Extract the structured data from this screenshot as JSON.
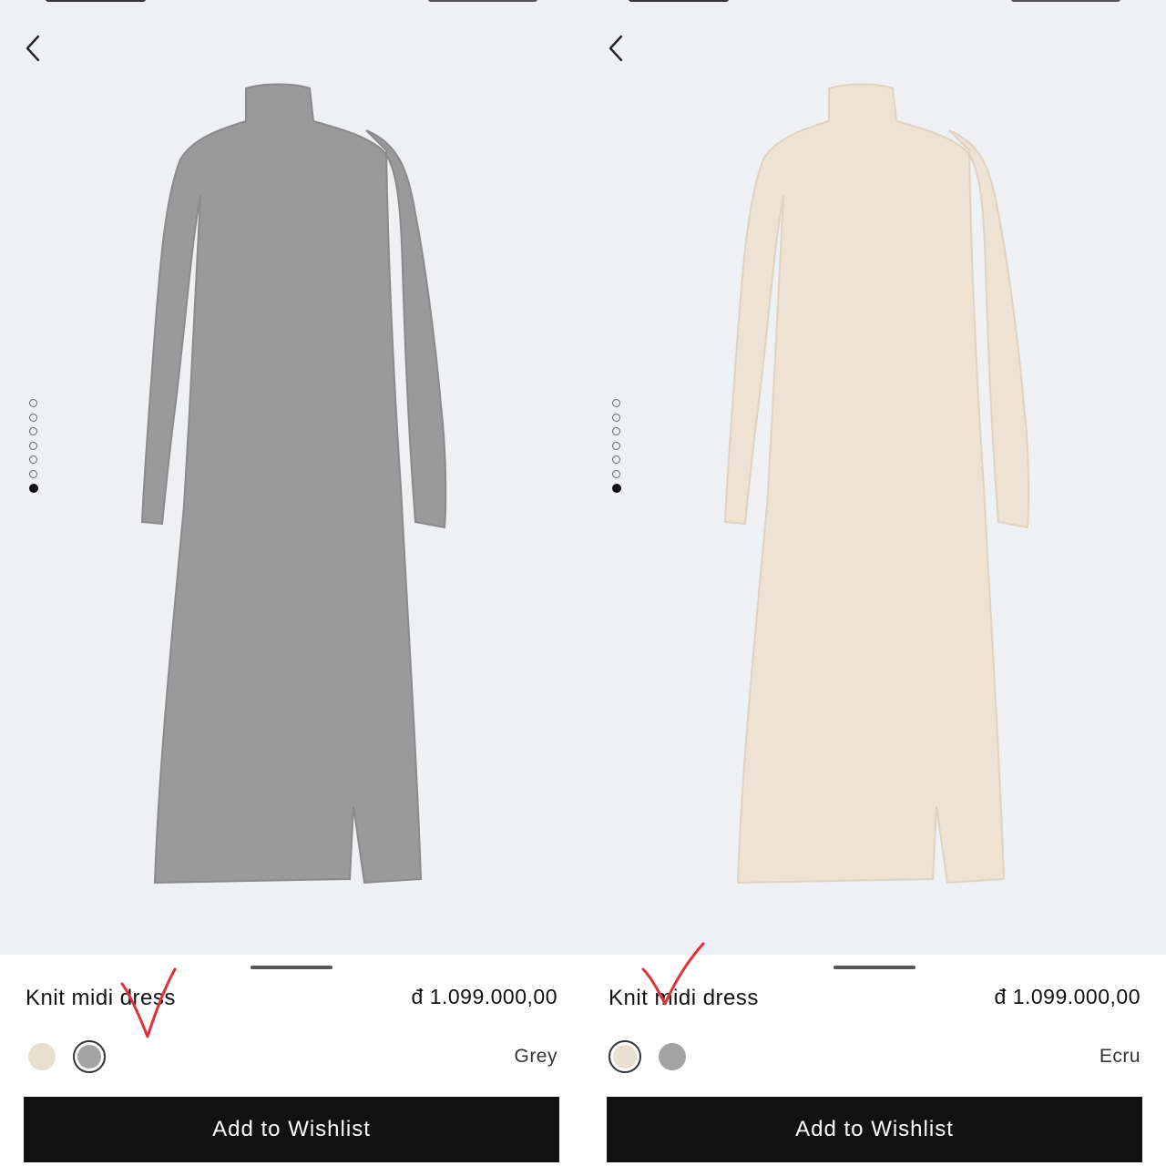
{
  "products": [
    {
      "name": "Knit midi dress",
      "price": "đ 1.099.000,00",
      "selected_color": "Grey",
      "swatches": [
        {
          "color_name": "Ecru",
          "hex": "#e9dfd0"
        },
        {
          "color_name": "Grey",
          "hex": "#a3a3a3"
        }
      ],
      "selected_swatch_index": 1,
      "dress_color": "#9a9a9a",
      "dress_shade": "#8a8a8a",
      "image_pager": {
        "count": 7,
        "active_index": 6
      },
      "wishlist_label": "Add to Wishlist"
    },
    {
      "name": "Knit midi dress",
      "price": "đ 1.099.000,00",
      "selected_color": "Ecru",
      "swatches": [
        {
          "color_name": "Ecru",
          "hex": "#e9dfd0"
        },
        {
          "color_name": "Grey",
          "hex": "#a3a3a3"
        }
      ],
      "selected_swatch_index": 0,
      "dress_color": "#ede2d3",
      "dress_shade": "#dfd2c1",
      "image_pager": {
        "count": 7,
        "active_index": 6
      },
      "wishlist_label": "Add to Wishlist"
    }
  ],
  "colors": {
    "photo_background": "#eef0f4",
    "button_background": "#111111",
    "checkmark": "#e0303a"
  },
  "icons": {
    "back": "chevron-left-icon",
    "annotation": "red-checkmark"
  }
}
